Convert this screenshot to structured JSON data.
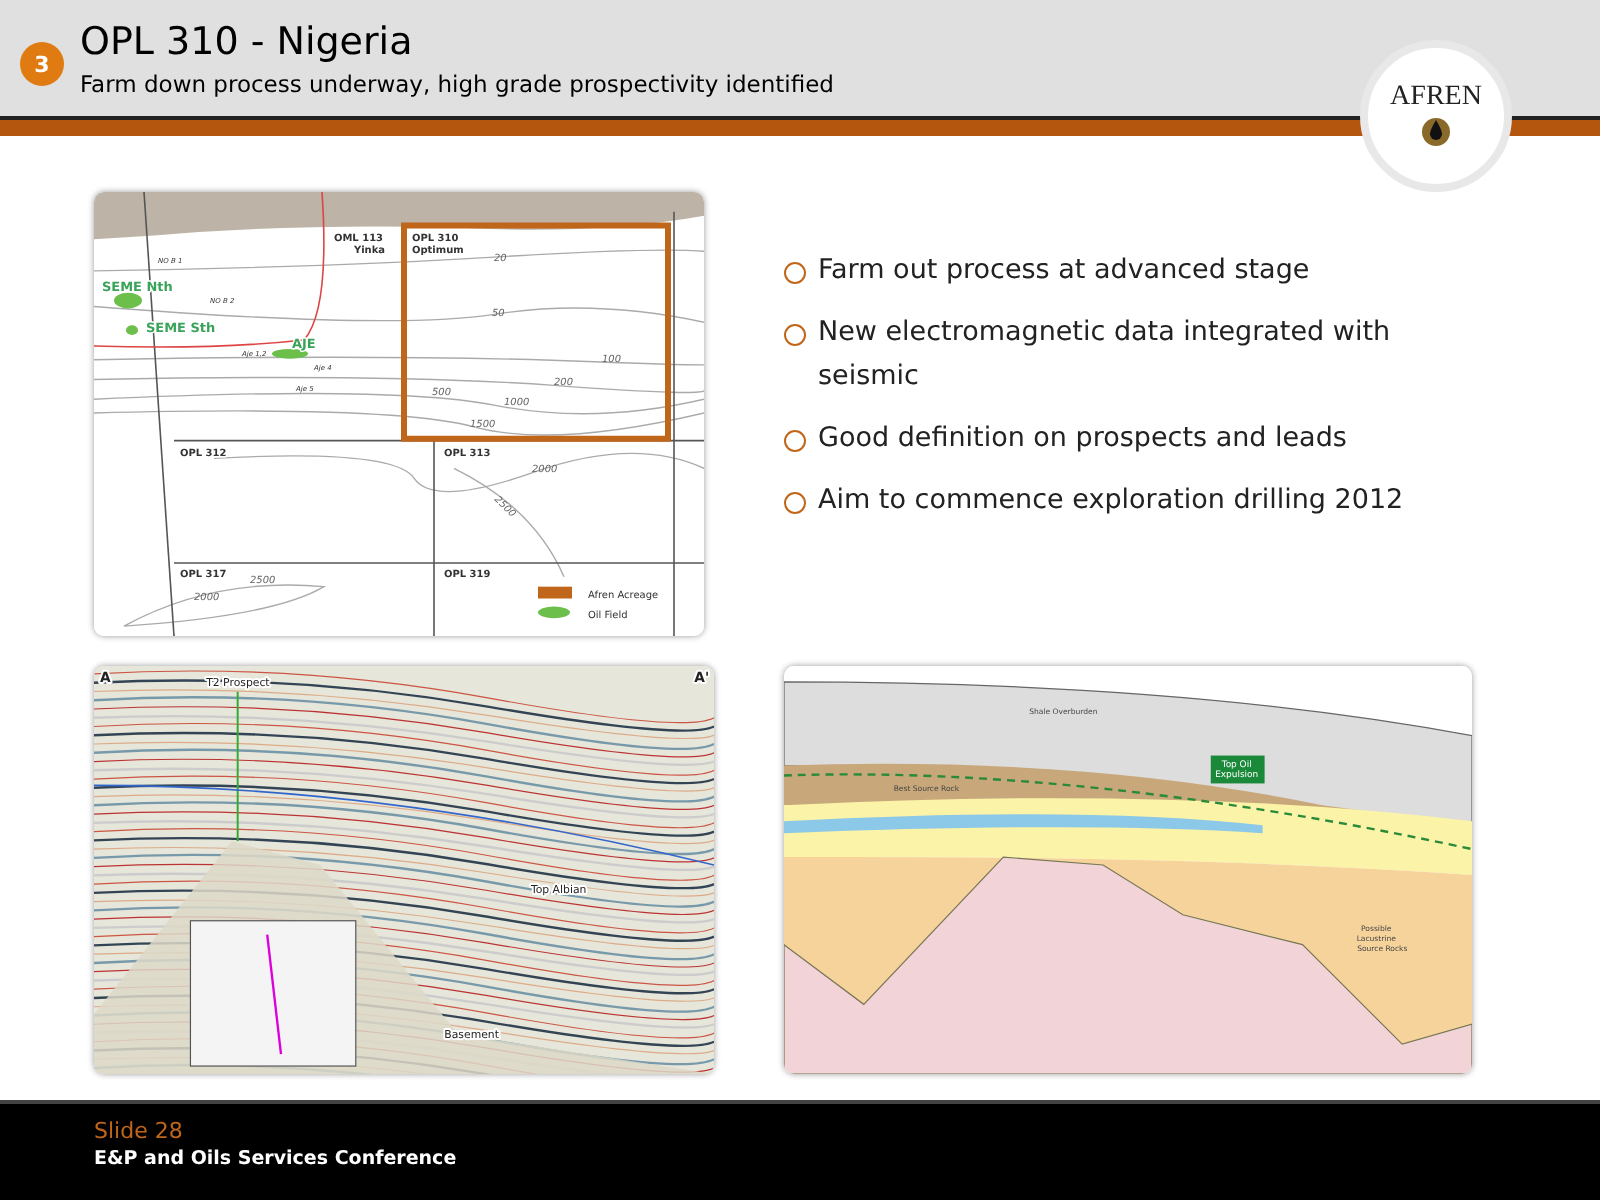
{
  "header": {
    "number": "3",
    "title": "OPL 310 - Nigeria",
    "subtitle": "Farm down process underway, high grade prospectivity identified",
    "logo": "AFREN"
  },
  "map": {
    "labels": [
      {
        "text": "OML 113",
        "kind": "block"
      },
      {
        "text": "Yinka",
        "kind": "block"
      },
      {
        "text": "OPL 310",
        "kind": "block"
      },
      {
        "text": "Optimum",
        "kind": "block"
      },
      {
        "text": "SEME Nth",
        "kind": "field"
      },
      {
        "text": "SEME Sth",
        "kind": "field"
      },
      {
        "text": "AJE",
        "kind": "field"
      },
      {
        "text": "NO B 1",
        "kind": "well"
      },
      {
        "text": "NO B 2",
        "kind": "well"
      },
      {
        "text": "Aje 1,2",
        "kind": "well"
      },
      {
        "text": "Aje 4",
        "kind": "well"
      },
      {
        "text": "Aje 5",
        "kind": "well"
      },
      {
        "text": "20",
        "kind": "contour"
      },
      {
        "text": "50",
        "kind": "contour"
      },
      {
        "text": "100",
        "kind": "contour"
      },
      {
        "text": "200",
        "kind": "contour"
      },
      {
        "text": "500",
        "kind": "contour"
      },
      {
        "text": "1000",
        "kind": "contour"
      },
      {
        "text": "1500",
        "kind": "contour"
      },
      {
        "text": "2000",
        "kind": "contour"
      },
      {
        "text": "2500",
        "kind": "contour"
      },
      {
        "text": "OPL 312",
        "kind": "block"
      },
      {
        "text": "OPL 313",
        "kind": "block"
      },
      {
        "text": "OPL 317",
        "kind": "block"
      },
      {
        "text": "OPL 319",
        "kind": "block"
      },
      {
        "text": "2500",
        "kind": "contour"
      },
      {
        "text": "2000",
        "kind": "contour"
      }
    ],
    "legend": [
      {
        "text": "Afren Acreage",
        "kind": "acreage"
      },
      {
        "text": "Oil Field",
        "kind": "field"
      }
    ]
  },
  "bullets": [
    "Farm out process at advanced stage",
    "New electromagnetic data integrated with seismic",
    "Good definition on prospects and leads",
    "Aim to commence exploration drilling 2012"
  ],
  "seismic": {
    "labels": [
      "A",
      "A'",
      "T2 Prospect",
      "Top Albian",
      "Basement"
    ]
  },
  "section": {
    "labels": [
      "Shale Overburden",
      "Best Source Rock",
      "Top Oil Expulsion",
      "Possible Lacustrine Source Rocks"
    ]
  },
  "footer": {
    "slide": "Slide 28",
    "event": "E&P and Oils Services Conference"
  }
}
